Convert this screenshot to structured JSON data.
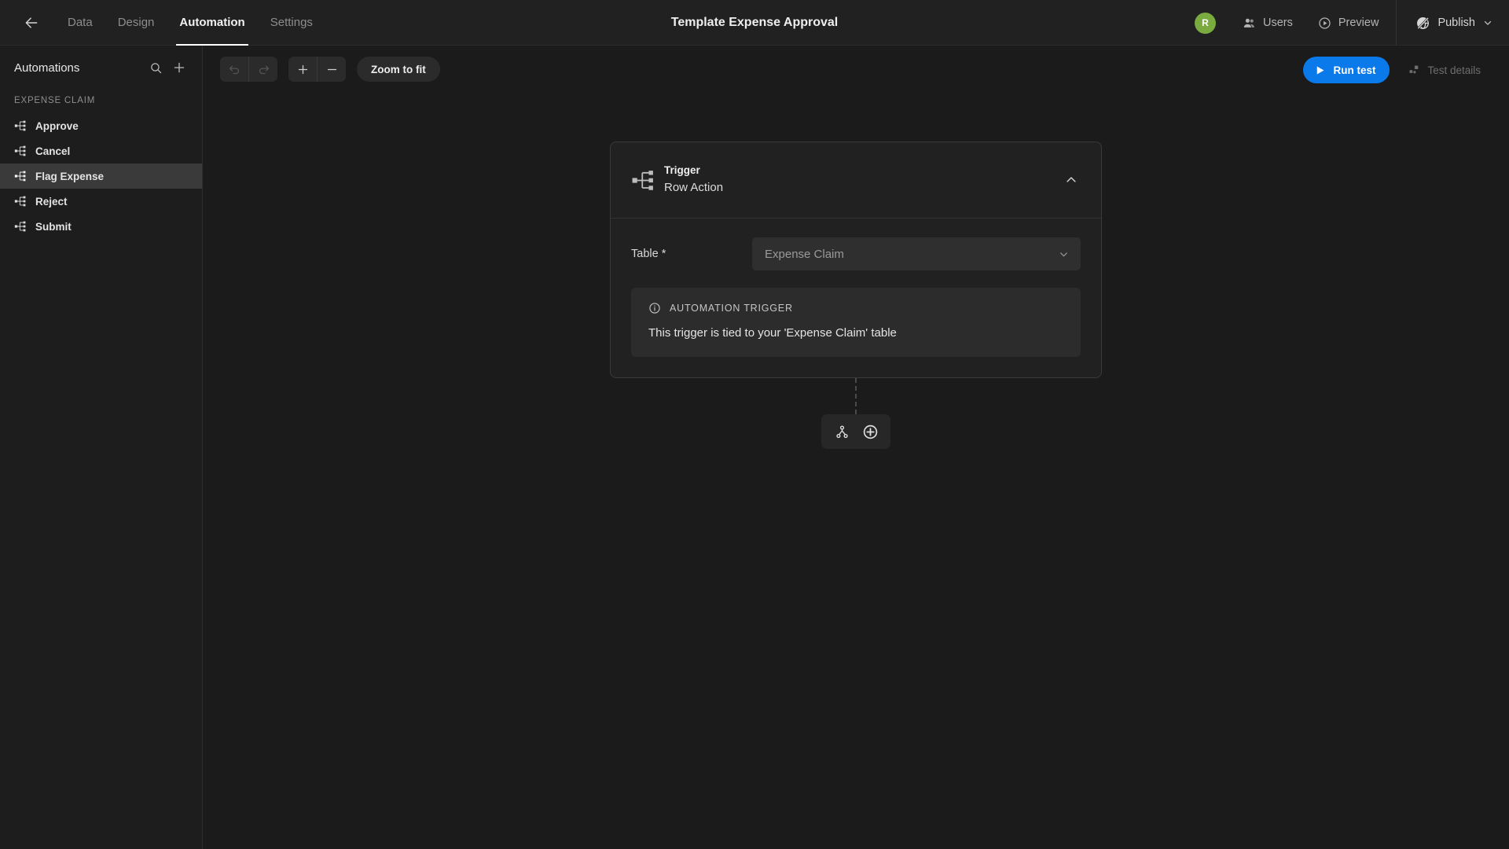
{
  "header": {
    "back_icon": "arrow-left-icon",
    "title": "Template Expense Approval",
    "tabs": [
      {
        "label": "Data",
        "active": false
      },
      {
        "label": "Design",
        "active": false
      },
      {
        "label": "Automation",
        "active": true
      },
      {
        "label": "Settings",
        "active": false
      }
    ],
    "avatar": {
      "initial": "R",
      "color": "#7aab3f"
    },
    "users_label": "Users",
    "users_icon": "users-icon",
    "preview_label": "Preview",
    "preview_icon": "play-circle-icon",
    "publish_label": "Publish",
    "publish_icon": "globe-slash-icon",
    "publish_chevron_icon": "chevron-down-icon"
  },
  "sidebar": {
    "title": "Automations",
    "search_icon": "search-icon",
    "add_icon": "plus-icon",
    "group_label": "EXPENSE CLAIM",
    "items": [
      {
        "label": "Approve",
        "icon": "workflow-icon",
        "selected": false
      },
      {
        "label": "Cancel",
        "icon": "workflow-icon",
        "selected": false
      },
      {
        "label": "Flag Expense",
        "icon": "workflow-icon",
        "selected": true
      },
      {
        "label": "Reject",
        "icon": "workflow-icon",
        "selected": false
      },
      {
        "label": "Submit",
        "icon": "workflow-icon",
        "selected": false
      }
    ]
  },
  "toolbar": {
    "undo_icon": "undo-icon",
    "redo_icon": "redo-icon",
    "zoom_in_icon": "plus-icon",
    "zoom_out_icon": "minus-icon",
    "zoom_to_fit_label": "Zoom to fit",
    "run_test_label": "Run test",
    "run_test_icon": "play-icon",
    "run_test_color": "#0a7aeb",
    "test_details_label": "Test details",
    "test_details_icon": "blocks-icon"
  },
  "flow": {
    "node": {
      "icon": "workflow-icon",
      "kicker": "Trigger",
      "subtitle": "Row Action",
      "collapse_icon": "chevron-up-icon",
      "field": {
        "label": "Table *",
        "value": "Expense Claim",
        "chevron_icon": "chevron-down-icon"
      },
      "callout": {
        "icon": "info-circle-icon",
        "title": "AUTOMATION TRIGGER",
        "body": "This trigger is tied to your 'Expense Claim' table"
      }
    },
    "branch_bar": {
      "branch_icon": "branch-icon",
      "add_icon": "plus-circle-icon"
    }
  }
}
